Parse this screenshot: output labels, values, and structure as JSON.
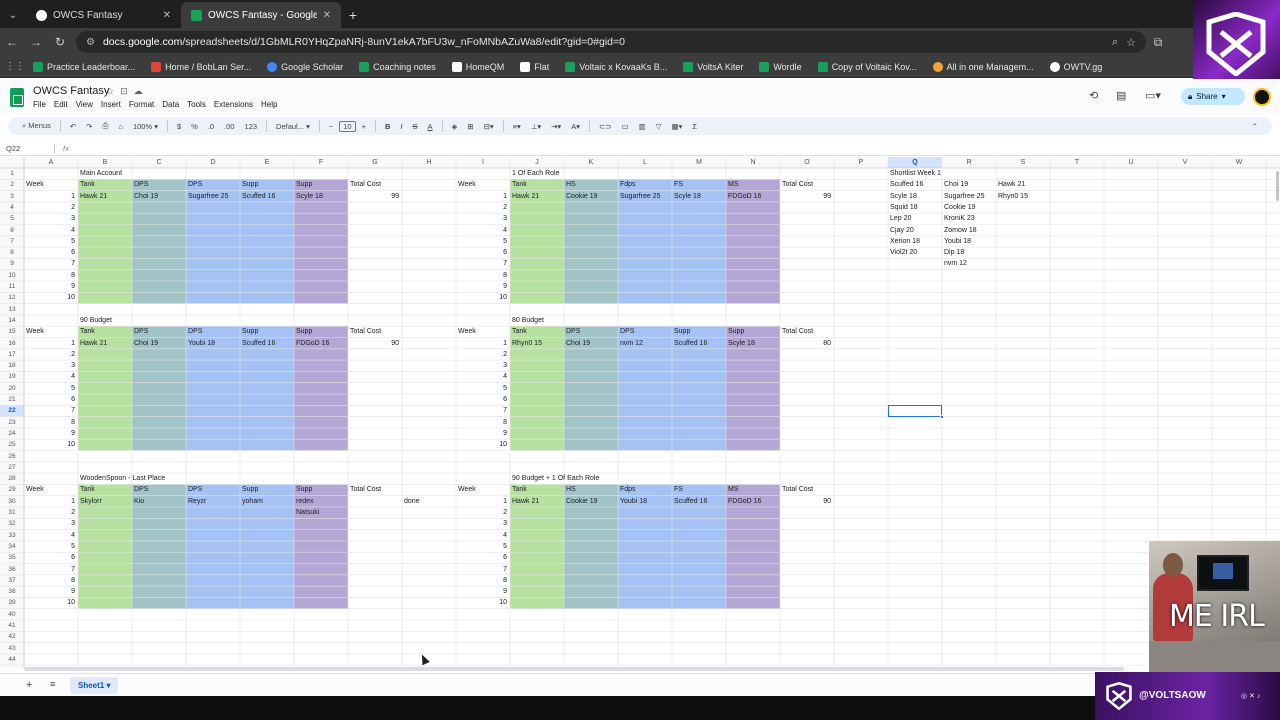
{
  "browser": {
    "tabs": [
      {
        "title": "OWCS Fantasy",
        "active": false
      },
      {
        "title": "OWCS Fantasy - Google Sheets",
        "active": true
      }
    ],
    "url_host": "docs.google.com",
    "url_path": "/spreadsheets/d/1GbMLR0YHqZpaNRj-8unV1ekA7bFU3w_nFoMNbAZuWa8/edit?gid=0#gid=0",
    "bookmarks": [
      {
        "label": "Practice Leaderboar...",
        "color": "#18a15d"
      },
      {
        "label": "Home / BobLan Ser...",
        "color": "#e0453a"
      },
      {
        "label": "Google Scholar",
        "color": "#4285f4"
      },
      {
        "label": "Coaching notes",
        "color": "#18a15d"
      },
      {
        "label": "HomeQM",
        "color": "#ffffff"
      },
      {
        "label": "Flat",
        "color": "#ffffff"
      },
      {
        "label": "Voltaic x KovaaKs B...",
        "color": "#18a15d"
      },
      {
        "label": "VoltsA Kiter",
        "color": "#18a15d"
      },
      {
        "label": "Wordle",
        "color": "#18a15d"
      },
      {
        "label": "Copy of Voltaic Kov...",
        "color": "#18a15d"
      },
      {
        "label": "All in one Managem...",
        "color": "#f4a23b"
      },
      {
        "label": "OWTV.gg",
        "color": "#ffffff"
      }
    ]
  },
  "sheets": {
    "doc_title": "OWCS Fantasy",
    "menus": [
      "File",
      "Edit",
      "View",
      "Insert",
      "Format",
      "Data",
      "Tools",
      "Extensions",
      "Help"
    ],
    "share_label": "Share",
    "toolbar": {
      "menus": "Menus",
      "zoom": "100%",
      "currency": "$",
      "percent": "%",
      "dec_less": ".0",
      "dec_more": ".00",
      "format_123": "123",
      "font": "Defaul...",
      "font_size": "10"
    },
    "name_box": "Q22",
    "fx": "fx",
    "sheet_tab": "Sheet1"
  },
  "grid": {
    "columns": [
      "A",
      "B",
      "C",
      "D",
      "E",
      "F",
      "G",
      "H",
      "I",
      "J",
      "K",
      "L",
      "M",
      "N",
      "O",
      "P",
      "Q",
      "R",
      "S",
      "T",
      "U",
      "V",
      "W"
    ],
    "selected_column": "Q",
    "selected_row": 22,
    "first_row": 1,
    "last_row": 44,
    "colors": {
      "tank": "#b7e1a1",
      "hs": "#a2c4c9",
      "dps": "#a4c2f4",
      "supp": "#b4a7d6"
    },
    "labels": {
      "week": "Week",
      "tank": "Tank",
      "dps": "DPS",
      "supp": "Supp",
      "hs": "HS",
      "fdps": "Fdps",
      "fs": "FS",
      "ms": "MS",
      "total_cost": "Total Cost"
    },
    "blocks": [
      {
        "title": "Main Account",
        "roles": [
          "Tank",
          "DPS",
          "DPS",
          "Supp",
          "Supp"
        ],
        "picks": [
          "Hawk 21",
          "Choi 19",
          "Sugarfree 25",
          "Scuffed 16",
          "Scyle 18"
        ],
        "total": "99",
        "extra": []
      },
      {
        "title": "1 Of Each Role",
        "roles": [
          "Tank",
          "HS",
          "Fdps",
          "FS",
          "MS"
        ],
        "picks": [
          "Hawk 21",
          "Cookie 19",
          "Sugarfree 25",
          "Scyle 18",
          "FDGoD 16"
        ],
        "total": "99",
        "extra": []
      },
      {
        "title": "90 Budget",
        "roles": [
          "Tank",
          "DPS",
          "DPS",
          "Supp",
          "Supp"
        ],
        "picks": [
          "Hawk 21",
          "Choi 19",
          "Youbi 18",
          "Scuffed 16",
          "FDGoD 16"
        ],
        "total": "90",
        "extra": []
      },
      {
        "title": "80 Budget",
        "roles": [
          "Tank",
          "DPS",
          "DPS",
          "Supp",
          "Supp"
        ],
        "picks": [
          "Rhyn0 15",
          "Choi 19",
          "nvm 12",
          "Scuffed 16",
          "Scyle 18"
        ],
        "total": "80",
        "extra": []
      },
      {
        "title": "WoodenSpoon - Last Place",
        "roles": [
          "Tank",
          "DPS",
          "DPS",
          "Supp",
          "Supp"
        ],
        "picks": [
          "Skylorr",
          "Kio",
          "Reyzr",
          "yoham",
          "redex"
        ],
        "total": "",
        "extra": [
          "Natsuki"
        ],
        "note": "done"
      },
      {
        "title": "90 Budget + 1 Of Each Role",
        "roles": [
          "Tank",
          "HS",
          "Fdps",
          "FS",
          "MS"
        ],
        "picks": [
          "Hawk 21",
          "Cookie 19",
          "Youbi 18",
          "Scuffed 16",
          "FDGoD 16"
        ],
        "total": "90",
        "extra": []
      }
    ],
    "shortlist": {
      "title": "Shortlist Week 1",
      "col_q": [
        "Scuffed 16",
        "Scyle 18",
        "Squid 18",
        "Lep 20",
        "Cjay 20",
        "Xerion 18",
        "Viol2t 20"
      ],
      "col_r": [
        "Choi 19",
        "Sugarfree 25",
        "Cookie 19",
        "KroniK 23",
        "Zomow 18",
        "Youbi 18",
        "Dip 18",
        "nvm 12"
      ],
      "col_s": [
        "Hawk 21",
        "Rhyn0 15"
      ]
    }
  },
  "stream": {
    "webcam_label": "ME IRL",
    "handle": "@VOLTSAOW"
  }
}
